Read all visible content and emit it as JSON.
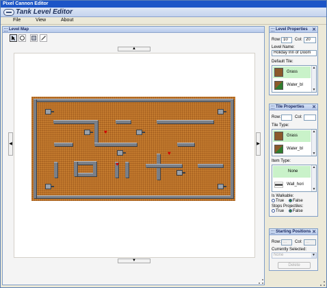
{
  "window": {
    "title": "Pixel Cannon Editor"
  },
  "brand": {
    "title": "Tank Level Editor"
  },
  "menu": [
    "File",
    "View",
    "About"
  ],
  "level_map": {
    "title": "Level Map",
    "tools": [
      "select-arrow-icon",
      "pan-icon",
      "tile-icon",
      "pencil-icon"
    ],
    "scroll_up": "▲",
    "scroll_down": "▼",
    "scroll_left": "◀",
    "scroll_right": "▶"
  },
  "level_properties": {
    "title": "Level Properties",
    "row_label": "Row:",
    "row_value": "10",
    "col_label": "Col:",
    "col_value": "20",
    "name_label": "Level Name:",
    "name_value": "Holiday Inn of Doom",
    "default_tile_label": "Default Tile:",
    "tiles": [
      {
        "name": "Grass",
        "color": "#8b5a2b"
      },
      {
        "name": "Water_bl",
        "color": "#8b5a2b"
      }
    ]
  },
  "tile_properties": {
    "title": "Tile Properties",
    "row_label": "Row:",
    "col_label": "Col:",
    "tile_type_label": "Tile Type:",
    "tiles": [
      {
        "name": "Grass",
        "color": "#8b5a2b"
      },
      {
        "name": "Water_bl",
        "color": "#8b5a2b"
      }
    ],
    "item_type_label": "Item Type:",
    "items": [
      {
        "name": "None"
      },
      {
        "name": "Wall_hori"
      }
    ],
    "walkable_label": "Is Walkable:",
    "stops_label": "Stops Projectiles:",
    "true_label": "True",
    "false_label": "False"
  },
  "starting_positions": {
    "title": "Starting Positions",
    "row_label": "Row:",
    "row_value": "...",
    "col_label": "Col:",
    "col_value": "...",
    "selected_label": "Currently Selected:",
    "selected_value": "None",
    "delete_label": "Delete"
  },
  "colors": {
    "title_bar": "#1c55c7",
    "dirt": "#c57c2f",
    "wall": "#7a7f87",
    "selection": "#c9f2c9"
  }
}
